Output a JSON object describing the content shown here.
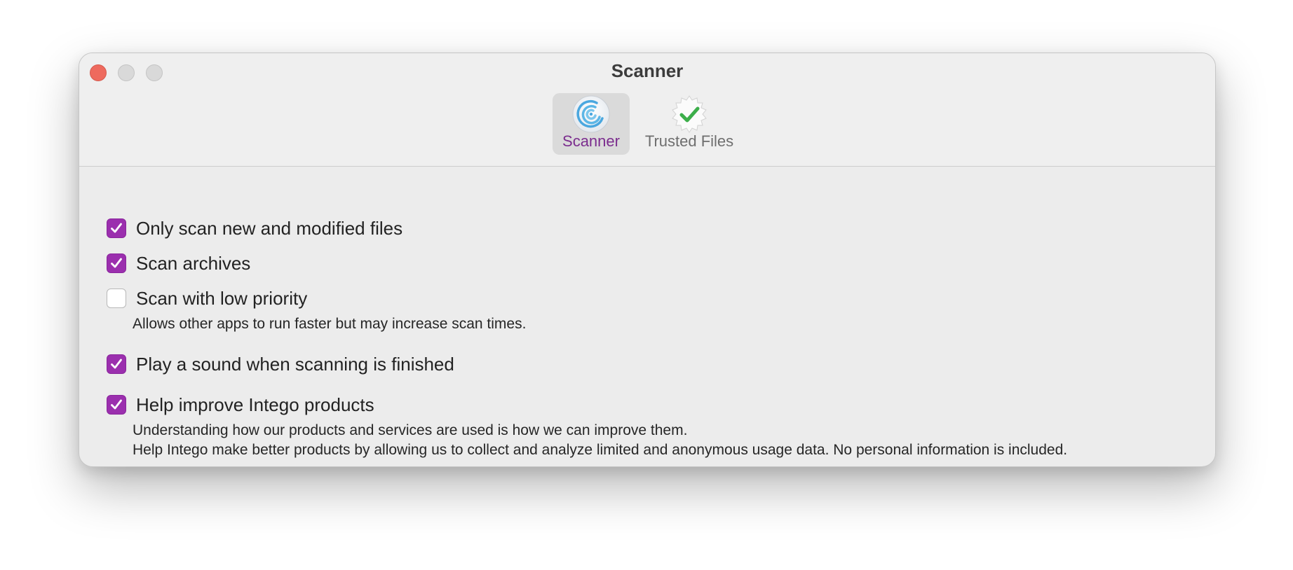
{
  "window": {
    "title": "Scanner"
  },
  "tabs": [
    {
      "label": "Scanner",
      "icon": "scanner-radar-icon",
      "selected": true
    },
    {
      "label": "Trusted Files",
      "icon": "verified-check-badge-icon",
      "selected": false
    }
  ],
  "options": [
    {
      "label": "Only scan new and modified files",
      "checked": true
    },
    {
      "label": "Scan archives",
      "checked": true
    },
    {
      "label": "Scan with low priority",
      "checked": false,
      "description": "Allows other apps to run faster but may increase scan times."
    },
    {
      "label": "Play a sound when scanning is finished",
      "checked": true
    },
    {
      "label": "Help improve Intego products",
      "checked": true,
      "description_lines": [
        "Understanding how our products and services are used is how we can improve them.",
        "Help Intego make better products by allowing us to collect and analyze limited and anonymous usage data. No personal information is included."
      ]
    }
  ],
  "colors": {
    "accent": "#9b2fae",
    "selected_tab_text": "#7b2d8e",
    "close_button": "#ee6a5e",
    "check_green": "#3cae4a"
  }
}
